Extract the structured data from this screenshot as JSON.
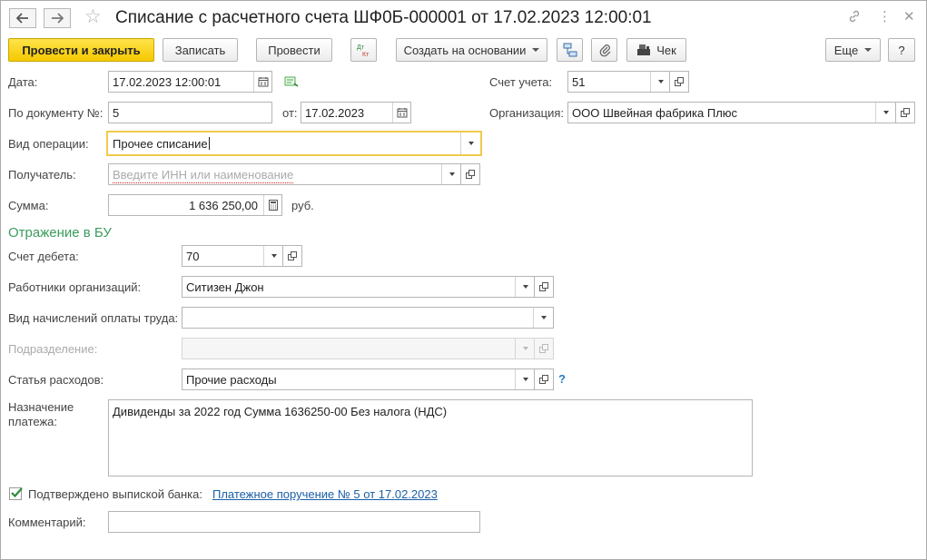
{
  "window": {
    "title": "Списание с расчетного счета ШФ0Б-000001 от 17.02.2023 12:00:01",
    "nav_back_icon": "arrow-left-icon",
    "nav_forward_icon": "arrow-right-icon",
    "favorite_icon": "star-icon",
    "controls": [
      "link-icon",
      "more-vertical-icon",
      "close-icon"
    ]
  },
  "toolbar": {
    "post_close_label": "Провести и закрыть",
    "save_label": "Записать",
    "post_label": "Провести",
    "dt_kt_icon": "dt-kt-icon",
    "create_based_label": "Создать на основании",
    "structure_icon": "structure-icon",
    "attach_icon": "paperclip-icon",
    "receipt_label": "Чек",
    "more_label": "Еще",
    "help_label": "?"
  },
  "form": {
    "date": {
      "label": "Дата:",
      "value": "17.02.2023 12:00:01"
    },
    "doc_number": {
      "label": "По документу №:",
      "value": "5",
      "from_label": "от:",
      "from_value": "17.02.2023"
    },
    "account": {
      "label": "Счет учета:",
      "value": "51"
    },
    "organization": {
      "label": "Организация:",
      "value": "ООО Швейная фабрика Плюс"
    },
    "operation_type": {
      "label": "Вид операции:",
      "value": "Прочее списание"
    },
    "recipient": {
      "label": "Получатель:",
      "placeholder": "Введите ИНН или наименование"
    },
    "amount": {
      "label": "Сумма:",
      "value": "1 636 250,00",
      "currency": "руб."
    }
  },
  "accounting": {
    "section_title": "Отражение в БУ",
    "debit_account": {
      "label": "Счет дебета:",
      "value": "70"
    },
    "employees": {
      "label": "Работники организаций:",
      "value": "Ситизен Джон"
    },
    "payroll_type": {
      "label": "Вид начислений оплаты труда:",
      "value": ""
    },
    "department": {
      "label": "Подразделение:",
      "value": ""
    },
    "expense_item": {
      "label": "Статья расходов:",
      "value": "Прочие расходы",
      "help": "?"
    }
  },
  "payment_purpose": {
    "label_line1": "Назначение",
    "label_line2": "платежа:",
    "value": "Дивиденды за 2022 год Сумма 1636250-00 Без налога (НДС)"
  },
  "confirmation": {
    "checked": true,
    "label": "Подтверждено выпиской банка:",
    "link_text": "Платежное поручение № 5 от 17.02.2023"
  },
  "comment": {
    "label": "Комментарий:",
    "value": ""
  },
  "colors": {
    "accent_yellow": "#f5c800",
    "section_green": "#3b9c5e",
    "link_blue": "#1a5fa6",
    "focus_border": "#f2c94c"
  }
}
